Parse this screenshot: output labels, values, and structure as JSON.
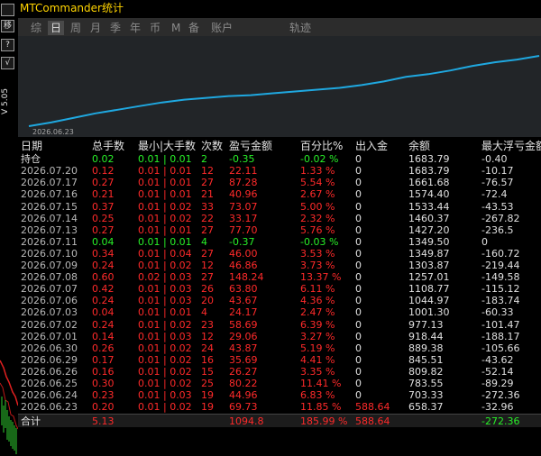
{
  "window": {
    "title": "MTCommander统计",
    "version": "V 5.05",
    "side_buttons": [
      "移",
      "?",
      "√"
    ]
  },
  "tabs": [
    "综",
    "日",
    "周",
    "月",
    "季",
    "年",
    "币",
    "M",
    "备",
    "账户",
    "轨迹"
  ],
  "active_tab": "日",
  "equity_chart": {
    "start_label": "2026.06.23",
    "line_color": "#1fa8e0",
    "points": [
      0,
      4,
      9,
      14,
      18,
      22,
      26,
      29,
      31,
      33,
      34,
      36,
      38,
      40,
      42,
      45,
      49,
      54,
      57,
      61,
      66,
      70,
      73,
      77
    ]
  },
  "table": {
    "headers": [
      "日期",
      "总手数",
      "最小|大手数",
      "次数",
      "盈亏金额",
      "百分比%",
      "出入金",
      "余额",
      "最大浮亏金额"
    ],
    "holding": {
      "date": "持仓",
      "lots": "0.02",
      "minmax": "0.01 | 0.01",
      "count": "2",
      "pnl": "-0.35",
      "pct": "-0.02 %",
      "io": "0",
      "balance": "1683.79",
      "dd": "-0.40"
    },
    "rows": [
      {
        "date": "2026.07.20",
        "lots": "0.12",
        "minmax": "0.01 | 0.01",
        "count": "12",
        "pnl": "22.11",
        "pct": "1.33 %",
        "io": "0",
        "balance": "1683.79",
        "dd": "-10.17",
        "color": "red"
      },
      {
        "date": "2026.07.17",
        "lots": "0.27",
        "minmax": "0.01 | 0.01",
        "count": "27",
        "pnl": "87.28",
        "pct": "5.54 %",
        "io": "0",
        "balance": "1661.68",
        "dd": "-76.57",
        "color": "red"
      },
      {
        "date": "2026.07.16",
        "lots": "0.21",
        "minmax": "0.01 | 0.01",
        "count": "21",
        "pnl": "40.96",
        "pct": "2.67 %",
        "io": "0",
        "balance": "1574.40",
        "dd": "-72.4",
        "color": "red"
      },
      {
        "date": "2026.07.15",
        "lots": "0.37",
        "minmax": "0.01 | 0.02",
        "count": "33",
        "pnl": "73.07",
        "pct": "5.00 %",
        "io": "0",
        "balance": "1533.44",
        "dd": "-43.53",
        "color": "red"
      },
      {
        "date": "2026.07.14",
        "lots": "0.25",
        "minmax": "0.01 | 0.02",
        "count": "22",
        "pnl": "33.17",
        "pct": "2.32 %",
        "io": "0",
        "balance": "1460.37",
        "dd": "-267.82",
        "color": "red"
      },
      {
        "date": "2026.07.13",
        "lots": "0.27",
        "minmax": "0.01 | 0.01",
        "count": "27",
        "pnl": "77.70",
        "pct": "5.76 %",
        "io": "0",
        "balance": "1427.20",
        "dd": "-236.5",
        "color": "red"
      },
      {
        "date": "2026.07.11",
        "lots": "0.04",
        "minmax": "0.01 | 0.01",
        "count": "4",
        "pnl": "-0.37",
        "pct": "-0.03 %",
        "io": "0",
        "balance": "1349.50",
        "dd": "0",
        "color": "green"
      },
      {
        "date": "2026.07.10",
        "lots": "0.34",
        "minmax": "0.01 | 0.04",
        "count": "27",
        "pnl": "46.00",
        "pct": "3.53 %",
        "io": "0",
        "balance": "1349.87",
        "dd": "-160.72",
        "color": "red"
      },
      {
        "date": "2026.07.09",
        "lots": "0.24",
        "minmax": "0.01 | 0.02",
        "count": "12",
        "pnl": "46.86",
        "pct": "3.73 %",
        "io": "0",
        "balance": "1303.87",
        "dd": "-219.44",
        "color": "red"
      },
      {
        "date": "2026.07.08",
        "lots": "0.60",
        "minmax": "0.02 | 0.03",
        "count": "27",
        "pnl": "148.24",
        "pct": "13.37 %",
        "io": "0",
        "balance": "1257.01",
        "dd": "-149.58",
        "color": "red"
      },
      {
        "date": "2026.07.07",
        "lots": "0.42",
        "minmax": "0.01 | 0.03",
        "count": "26",
        "pnl": "63.80",
        "pct": "6.11 %",
        "io": "0",
        "balance": "1108.77",
        "dd": "-115.12",
        "color": "red"
      },
      {
        "date": "2026.07.06",
        "lots": "0.24",
        "minmax": "0.01 | 0.03",
        "count": "20",
        "pnl": "43.67",
        "pct": "4.36 %",
        "io": "0",
        "balance": "1044.97",
        "dd": "-183.74",
        "color": "red"
      },
      {
        "date": "2026.07.03",
        "lots": "0.04",
        "minmax": "0.01 | 0.01",
        "count": "4",
        "pnl": "24.17",
        "pct": "2.47 %",
        "io": "0",
        "balance": "1001.30",
        "dd": "-60.33",
        "color": "red"
      },
      {
        "date": "2026.07.02",
        "lots": "0.24",
        "minmax": "0.01 | 0.02",
        "count": "23",
        "pnl": "58.69",
        "pct": "6.39 %",
        "io": "0",
        "balance": "977.13",
        "dd": "-101.47",
        "color": "red"
      },
      {
        "date": "2026.07.01",
        "lots": "0.14",
        "minmax": "0.01 | 0.03",
        "count": "12",
        "pnl": "29.06",
        "pct": "3.27 %",
        "io": "0",
        "balance": "918.44",
        "dd": "-188.17",
        "color": "red"
      },
      {
        "date": "2026.06.30",
        "lots": "0.26",
        "minmax": "0.01 | 0.02",
        "count": "24",
        "pnl": "43.87",
        "pct": "5.19 %",
        "io": "0",
        "balance": "889.38",
        "dd": "-105.66",
        "color": "red"
      },
      {
        "date": "2026.06.29",
        "lots": "0.17",
        "minmax": "0.01 | 0.02",
        "count": "16",
        "pnl": "35.69",
        "pct": "4.41 %",
        "io": "0",
        "balance": "845.51",
        "dd": "-43.62",
        "color": "red"
      },
      {
        "date": "2026.06.26",
        "lots": "0.16",
        "minmax": "0.01 | 0.02",
        "count": "15",
        "pnl": "26.27",
        "pct": "3.35 %",
        "io": "0",
        "balance": "809.82",
        "dd": "-52.14",
        "color": "red"
      },
      {
        "date": "2026.06.25",
        "lots": "0.30",
        "minmax": "0.01 | 0.02",
        "count": "25",
        "pnl": "80.22",
        "pct": "11.41 %",
        "io": "0",
        "balance": "783.55",
        "dd": "-89.29",
        "color": "red"
      },
      {
        "date": "2026.06.24",
        "lots": "0.23",
        "minmax": "0.01 | 0.03",
        "count": "19",
        "pnl": "44.96",
        "pct": "6.83 %",
        "io": "0",
        "balance": "703.33",
        "dd": "-272.36",
        "color": "red"
      },
      {
        "date": "2026.06.23",
        "lots": "0.20",
        "minmax": "0.01 | 0.02",
        "count": "19",
        "pnl": "69.73",
        "pct": "11.85 %",
        "io": "588.64",
        "balance": "658.37",
        "dd": "-32.96",
        "color": "red"
      }
    ],
    "total": {
      "date": "合计",
      "lots": "5.13",
      "minmax": "",
      "count": "",
      "pnl": "1094.8",
      "pct": "185.99 %",
      "io": "588.64",
      "balance": "",
      "dd": "-272.36"
    }
  },
  "colors": {
    "positive": "#ff2a2a",
    "negative": "#28f028",
    "title": "#ffd400",
    "chart_line": "#1fa8e0"
  }
}
